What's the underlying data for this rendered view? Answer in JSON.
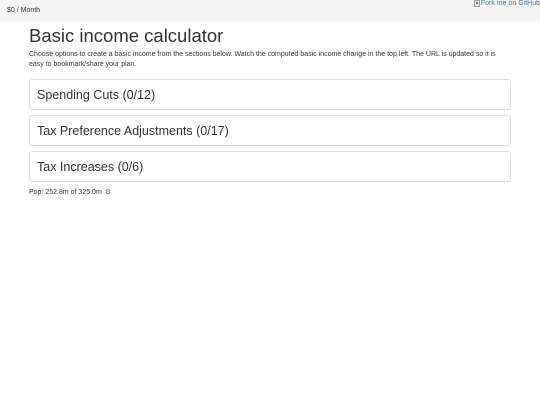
{
  "header": {
    "income_display": "$0 / Month",
    "fork_link_text": "Fork me on GitHub"
  },
  "main": {
    "title": "Basic income calculator",
    "intro": "Choose options to create a basic income from the sections below. Watch the computed basic income change in the top left. The URL is updated so it is easy to bookmark/share your plan.",
    "sections": [
      {
        "label": "Spending Cuts (0/12)"
      },
      {
        "label": "Tax Preference Adjustments (0/17)"
      },
      {
        "label": "Tax Increases (0/6)"
      }
    ],
    "population": "Pop: 252.8m of 325.0m",
    "settings_icon": "gear-icon"
  },
  "colors": {
    "link": "#337ab7",
    "topbar_bg": "#f5f5f5",
    "panel_border": "#dddddd"
  }
}
